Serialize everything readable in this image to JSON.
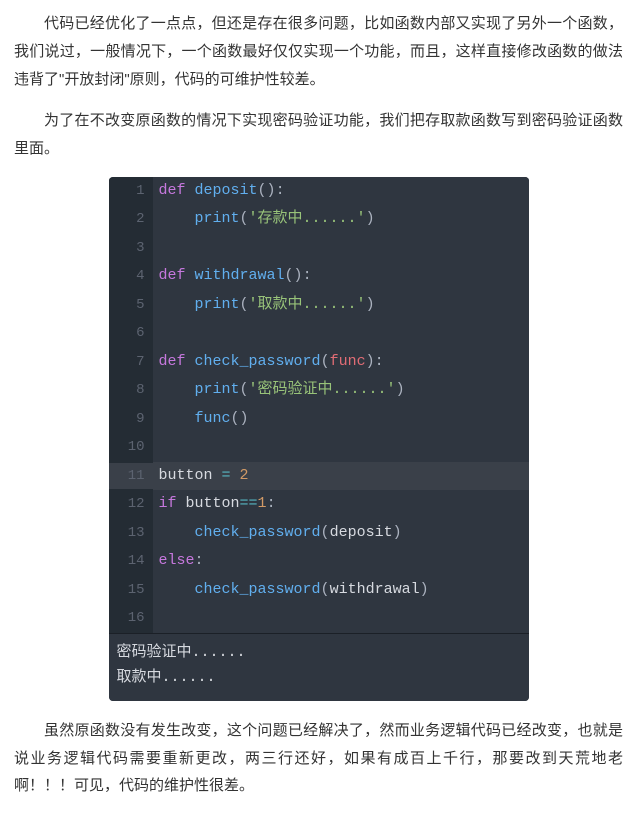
{
  "paragraphs": {
    "p1": "代码已经优化了一点点，但还是存在很多问题，比如函数内部又实现了另外一个函数，我们说过，一般情况下，一个函数最好仅仅实现一个功能，而且，这样直接修改函数的做法违背了\"开放封闭\"原则，代码的可维护性较差。",
    "p2": "为了在不改变原函数的情况下实现密码验证功能，我们把存取款函数写到密码验证函数里面。",
    "p3": "虽然原函数没有发生改变，这个问题已经解决了，然而业务逻辑代码已经改变，也就是说业务逻辑代码需要重新更改，两三行还好，如果有成百上千行，那要改到天荒地老啊！！！可见，代码的维护性很差。"
  },
  "code": {
    "lines": [
      {
        "n": "1",
        "tokens": [
          [
            "kw",
            "def"
          ],
          [
            "pl",
            " "
          ],
          [
            "fn",
            "deposit"
          ],
          [
            "pn",
            "()"
          ],
          [
            "pn",
            ":"
          ]
        ]
      },
      {
        "n": "2",
        "tokens": [
          [
            "pl",
            "    "
          ],
          [
            "call",
            "print"
          ],
          [
            "pn",
            "("
          ],
          [
            "str",
            "'存款中......'"
          ],
          [
            "pn",
            ")"
          ]
        ]
      },
      {
        "n": "3",
        "tokens": []
      },
      {
        "n": "4",
        "tokens": [
          [
            "kw",
            "def"
          ],
          [
            "pl",
            " "
          ],
          [
            "fn",
            "withdrawal"
          ],
          [
            "pn",
            "()"
          ],
          [
            "pn",
            ":"
          ]
        ]
      },
      {
        "n": "5",
        "tokens": [
          [
            "pl",
            "    "
          ],
          [
            "call",
            "print"
          ],
          [
            "pn",
            "("
          ],
          [
            "str",
            "'取款中......'"
          ],
          [
            "pn",
            ")"
          ]
        ]
      },
      {
        "n": "6",
        "tokens": []
      },
      {
        "n": "7",
        "tokens": [
          [
            "kw",
            "def"
          ],
          [
            "pl",
            " "
          ],
          [
            "fn",
            "check_password"
          ],
          [
            "pn",
            "("
          ],
          [
            "id",
            "func"
          ],
          [
            "pn",
            ")"
          ],
          [
            "pn",
            ":"
          ]
        ]
      },
      {
        "n": "8",
        "tokens": [
          [
            "pl",
            "    "
          ],
          [
            "call",
            "print"
          ],
          [
            "pn",
            "("
          ],
          [
            "str",
            "'密码验证中......'"
          ],
          [
            "pn",
            ")"
          ]
        ]
      },
      {
        "n": "9",
        "tokens": [
          [
            "pl",
            "    "
          ],
          [
            "call",
            "func"
          ],
          [
            "pn",
            "()"
          ]
        ]
      },
      {
        "n": "10",
        "tokens": []
      },
      {
        "n": "11",
        "current": true,
        "tokens": [
          [
            "pl",
            "button "
          ],
          [
            "op",
            "="
          ],
          [
            "pl",
            " "
          ],
          [
            "num",
            "2"
          ]
        ]
      },
      {
        "n": "12",
        "tokens": [
          [
            "kw",
            "if"
          ],
          [
            "pl",
            " button"
          ],
          [
            "op",
            "=="
          ],
          [
            "num",
            "1"
          ],
          [
            "pn",
            ":"
          ]
        ]
      },
      {
        "n": "13",
        "tokens": [
          [
            "pl",
            "    "
          ],
          [
            "call",
            "check_password"
          ],
          [
            "pn",
            "("
          ],
          [
            "pl",
            "deposit"
          ],
          [
            "pn",
            ")"
          ]
        ]
      },
      {
        "n": "14",
        "tokens": [
          [
            "kw",
            "else"
          ],
          [
            "pn",
            ":"
          ]
        ]
      },
      {
        "n": "15",
        "tokens": [
          [
            "pl",
            "    "
          ],
          [
            "call",
            "check_password"
          ],
          [
            "pn",
            "("
          ],
          [
            "pl",
            "withdrawal"
          ],
          [
            "pn",
            ")"
          ]
        ]
      },
      {
        "n": "16",
        "tokens": []
      }
    ]
  },
  "output": {
    "line1": "密码验证中......",
    "line2": "取款中......"
  }
}
